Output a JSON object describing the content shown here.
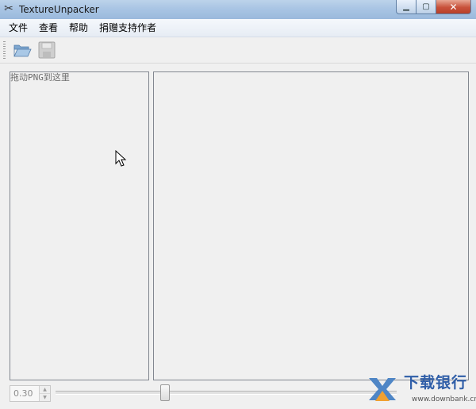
{
  "window": {
    "title": "TextureUnpacker",
    "app_icon": "scissors-icon",
    "controls": {
      "minimize": "minimize-icon",
      "maximize": "maximize-icon",
      "close": "close-icon"
    }
  },
  "menu": {
    "items": [
      {
        "label": "文件"
      },
      {
        "label": "查看"
      },
      {
        "label": "帮助"
      },
      {
        "label": "捐赠支持作者"
      }
    ]
  },
  "toolbar": {
    "buttons": [
      {
        "icon": "folder-open-icon"
      },
      {
        "icon": "save-icon",
        "enabled": false
      }
    ]
  },
  "left_panel": {
    "hint": "拖动PNG到这里"
  },
  "bottom": {
    "scale_value": "0.30",
    "slider_fraction": 0.32
  },
  "watermark": {
    "name": "下载银行",
    "url": "www.downbank.cn",
    "colors": {
      "blue": "#2f5ea8",
      "orange": "#f0a030"
    }
  }
}
